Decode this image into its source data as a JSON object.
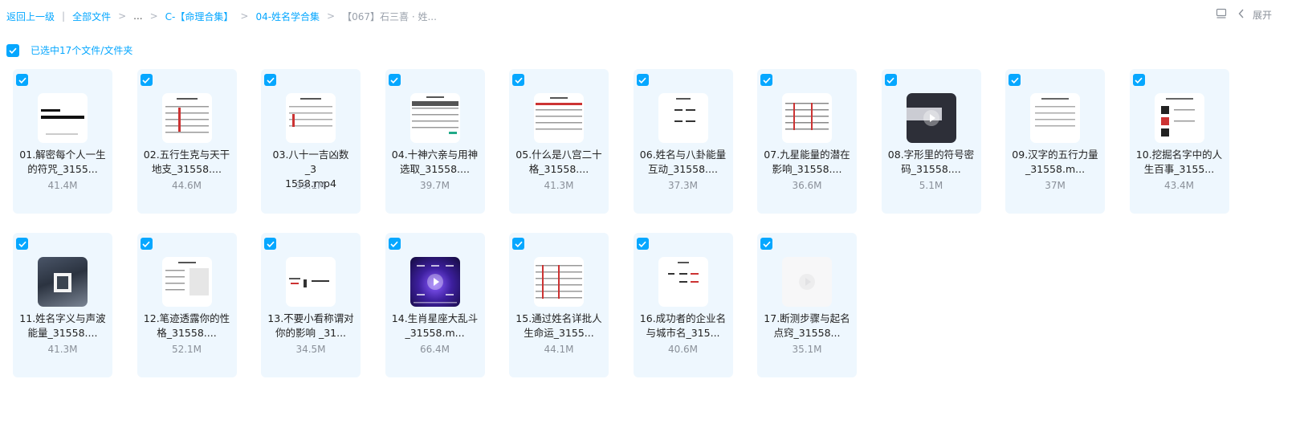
{
  "breadcrumb": {
    "back": "返回上一级",
    "all_files": "全部文件",
    "ellipsis": "...",
    "level1": "C-【命理合集】",
    "level2": "04-姓名学合集",
    "current": "【067】石三喜 · 姓..."
  },
  "toolbar": {
    "expand_label": "展开"
  },
  "selection": {
    "label": "已选中17个文件/文件夹"
  },
  "files": [
    {
      "line1": "01.解密每个人一生",
      "line2": "的符咒_3155...",
      "size": "41.4M"
    },
    {
      "line1": "02.五行生克与天干",
      "line2": "地支_31558....",
      "size": "44.6M"
    },
    {
      "line1": "03.八十一吉凶数_3",
      "line2": "1558.mp4",
      "size": "39.1M"
    },
    {
      "line1": "04.十神六亲与用神",
      "line2": "选取_31558....",
      "size": "39.7M"
    },
    {
      "line1": "05.什么是八宫二十",
      "line2": "格_31558....",
      "size": "41.3M"
    },
    {
      "line1": "06.姓名与八卦能量",
      "line2": "互动_31558....",
      "size": "37.3M"
    },
    {
      "line1": "07.九星能量的潜在",
      "line2": "影响_31558....",
      "size": "36.6M"
    },
    {
      "line1": "08.字形里的符号密",
      "line2": "码_31558....",
      "size": "5.1M"
    },
    {
      "line1": "09.汉字的五行力量",
      "line2": "_31558.m...",
      "size": "37M"
    },
    {
      "line1": "10.挖掘名字中的人",
      "line2": "生百事_3155...",
      "size": "43.4M"
    },
    {
      "line1": "11.姓名字义与声波",
      "line2": "能量_31558....",
      "size": "41.3M"
    },
    {
      "line1": "12.笔迹透露你的性",
      "line2": "格_31558....",
      "size": "52.1M"
    },
    {
      "line1": "13.不要小看称谓对",
      "line2": "你的影响 _31...",
      "size": "34.5M"
    },
    {
      "line1": "14.生肖星座大乱斗",
      "line2": "_31558.m...",
      "size": "66.4M"
    },
    {
      "line1": "15.通过姓名详批人",
      "line2": "生命运_3155...",
      "size": "44.1M"
    },
    {
      "line1": "16.成功者的企业名",
      "line2": "与城市名_315...",
      "size": "40.6M"
    },
    {
      "line1": "17.断测步骤与起名",
      "line2": "点窍_31558...",
      "size": "35.1M"
    }
  ]
}
